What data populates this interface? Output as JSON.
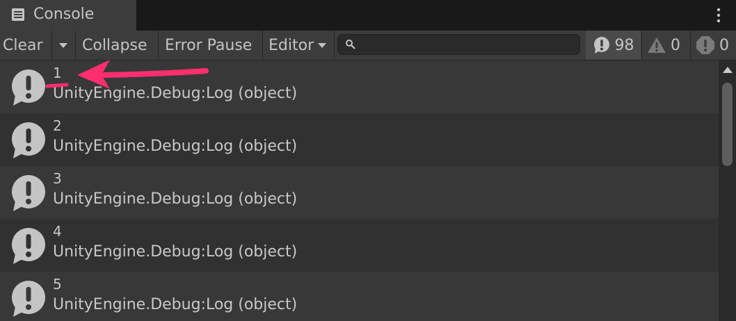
{
  "window": {
    "tab_title": "Console",
    "tab_icon": "console-list-icon",
    "menu_icon": "kebab-menu-icon"
  },
  "toolbar": {
    "clear_label": "Clear",
    "clear_dropdown_icon": "chevron-down-icon",
    "collapse_label": "Collapse",
    "error_pause_label": "Error Pause",
    "editor_label": "Editor",
    "editor_dropdown_icon": "chevron-down-icon",
    "search_placeholder": "",
    "search_icon": "search-icon",
    "log_count": "98",
    "warning_count": "0",
    "error_count": "0"
  },
  "entries": [
    {
      "number": "1",
      "message": "UnityEngine.Debug:Log (object)"
    },
    {
      "number": "2",
      "message": "UnityEngine.Debug:Log (object)"
    },
    {
      "number": "3",
      "message": "UnityEngine.Debug:Log (object)"
    },
    {
      "number": "4",
      "message": "UnityEngine.Debug:Log (object)"
    },
    {
      "number": "5",
      "message": "UnityEngine.Debug:Log (object)"
    }
  ],
  "colors": {
    "annotation_arrow": "#ff2e6e",
    "panel": "#3c3c3c",
    "row_odd": "#383838",
    "row_even": "#313131"
  }
}
